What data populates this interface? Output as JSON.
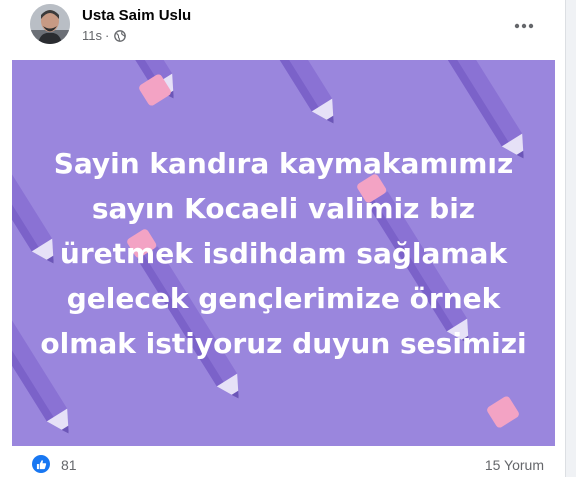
{
  "post": {
    "author": "Usta Saim Uslu",
    "time": "11s",
    "separator": "·",
    "privacy_icon": "globe-icon",
    "more_icon": "more-horizontal-icon",
    "text": "Sayin kandıra kaymakamımız sayın Kocaeli valimiz biz üretmek isdihdam sağlamak gelecek gençlerimize örnek olmak istiyoruz duyun sesimizi",
    "background_color": "#9a86dd"
  },
  "footer": {
    "reaction_icon": "like-icon",
    "reaction_count": "81",
    "comments": "15 Yorum"
  }
}
